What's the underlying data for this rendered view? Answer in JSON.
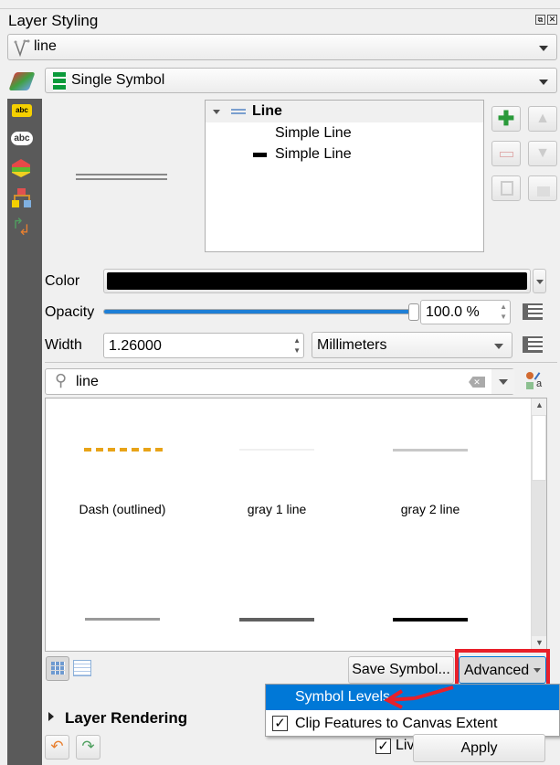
{
  "panel": {
    "title": "Layer Styling"
  },
  "layer_select": {
    "value": "line",
    "icon": "line-layer-icon"
  },
  "renderer_select": {
    "value": "Single Symbol",
    "icon": "single-symbol-icon"
  },
  "sidebar": {
    "items": [
      "labels-icon",
      "masks-icon",
      "3d-view-icon",
      "diagrams-icon",
      "history-icon"
    ]
  },
  "symbol_tree": {
    "root": "Line",
    "layers": [
      "Simple Line",
      "Simple Line"
    ]
  },
  "properties": {
    "color_label": "Color",
    "color_value": "#000000",
    "opacity_label": "Opacity",
    "opacity_value": "100.0 %",
    "opacity_percent": 100,
    "width_label": "Width",
    "width_value": "1.26000",
    "unit": "Millimeters"
  },
  "search": {
    "value": "line"
  },
  "symbols": [
    {
      "label": "Dash (outlined)",
      "preview": "#e8a317"
    },
    {
      "label": "gray 1 line",
      "preview": "#f0f0f0"
    },
    {
      "label": "gray 2 line",
      "preview": "#c8c8c8"
    },
    {
      "label": "",
      "preview": "#9a9a9a"
    },
    {
      "label": "",
      "preview": "#606060"
    },
    {
      "label": "",
      "preview": "#000000"
    }
  ],
  "buttons": {
    "save_symbol": "Save Symbol...",
    "advanced": "Advanced",
    "apply": "Apply",
    "live_update": "Live update"
  },
  "advanced_menu": {
    "items": [
      {
        "label": "Symbol Levels...",
        "highlighted": true
      },
      {
        "label": "Clip Features to Canvas Extent",
        "checked": true
      }
    ]
  },
  "layer_rendering": {
    "label": "Layer Rendering"
  },
  "colors": {
    "highlight": "#0078d7",
    "annotation": "#e8202a",
    "slider": "#1e7fd6"
  }
}
